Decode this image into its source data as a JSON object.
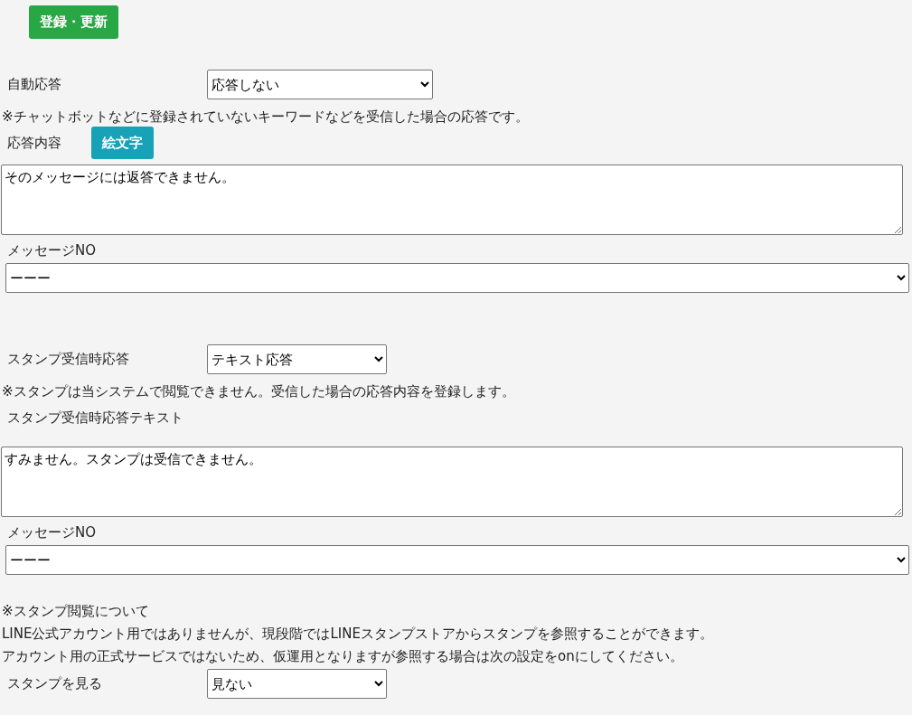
{
  "submit_button": "登録・更新",
  "auto_reply": {
    "label": "自動応答",
    "value": "応答しない"
  },
  "auto_reply_note": "※チャットボットなどに登録されていないキーワードなどを受信した場合の応答です。",
  "reply_content": {
    "label": "応答内容",
    "emoji_button": "絵文字",
    "text": "そのメッセージには返答できません。"
  },
  "message_no_1": {
    "label": "メッセージNO",
    "value": "ーーー"
  },
  "stamp_reply": {
    "label": "スタンプ受信時応答",
    "value": "テキスト応答"
  },
  "stamp_note": "※スタンプは当システムで閲覧できません。受信した場合の応答内容を登録します。",
  "stamp_reply_text": {
    "label": "スタンプ受信時応答テキスト",
    "text": "すみません。スタンプは受信できません。"
  },
  "message_no_2": {
    "label": "メッセージNO",
    "value": "ーーー"
  },
  "stamp_view_notes": [
    "※スタンプ閲覧について",
    "LINE公式アカウント用ではありませんが、現段階ではLINEスタンプストアからスタンプを参照することができます。",
    "アカウント用の正式サービスではないため、仮運用となりますが参照する場合は次の設定をonにしてください。"
  ],
  "stamp_view": {
    "label": "スタンプを見る",
    "value": "見ない"
  }
}
